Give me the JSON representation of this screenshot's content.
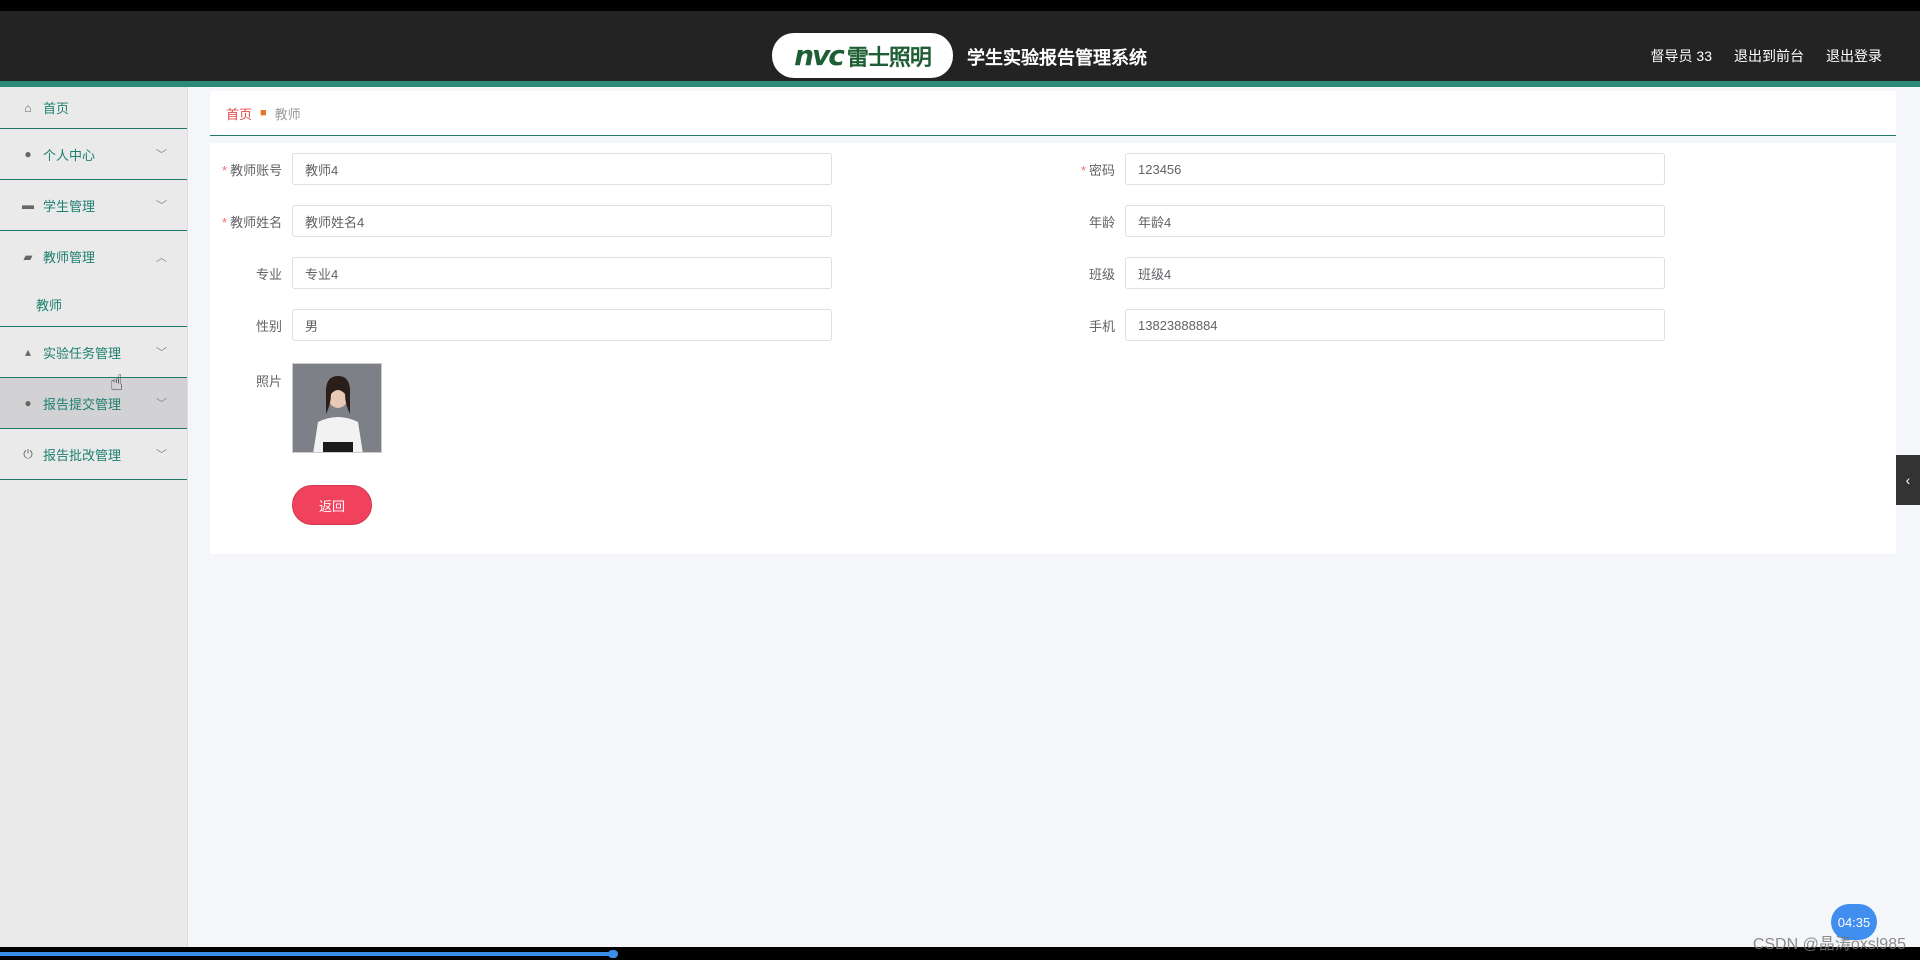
{
  "header": {
    "logo_mark": "nvc",
    "logo_text": "雷士照明",
    "title": "学生实验报告管理系统",
    "user_label": "督导员 33",
    "front_link": "退出到前台",
    "logout_link": "退出登录"
  },
  "sidebar": {
    "items": [
      {
        "label": "首页",
        "icon": "home-icon"
      },
      {
        "label": "个人中心",
        "icon": "user-icon"
      },
      {
        "label": "学生管理",
        "icon": "briefcase-icon"
      },
      {
        "label": "教师管理",
        "icon": "thumb-icon",
        "expanded": true,
        "children": [
          {
            "label": "教师"
          }
        ]
      },
      {
        "label": "实验任务管理",
        "icon": "person-icon"
      },
      {
        "label": "报告提交管理",
        "icon": "person-icon"
      },
      {
        "label": "报告批改管理",
        "icon": "power-icon"
      }
    ]
  },
  "breadcrumb": {
    "home": "首页",
    "current": "教师"
  },
  "form": {
    "teacher_account_label": "教师账号",
    "teacher_account_value": "教师4",
    "password_label": "密码",
    "password_value": "123456",
    "teacher_name_label": "教师姓名",
    "teacher_name_value": "教师姓名4",
    "age_label": "年龄",
    "age_value": "年龄4",
    "major_label": "专业",
    "major_value": "专业4",
    "class_label": "班级",
    "class_value": "班级4",
    "gender_label": "性别",
    "gender_value": "男",
    "phone_label": "手机",
    "phone_value": "13823888884",
    "photo_label": "照片",
    "back_button": "返回"
  },
  "overlay": {
    "timer": "04:35",
    "watermark": "CSDN @晶涛oxsl985",
    "video_progress": 0.32
  },
  "colors": {
    "header_bg": "#232323",
    "accent_teal": "#2a8c76",
    "back_button": "#f0425d",
    "breadcrumb_home": "#e14a4a"
  }
}
